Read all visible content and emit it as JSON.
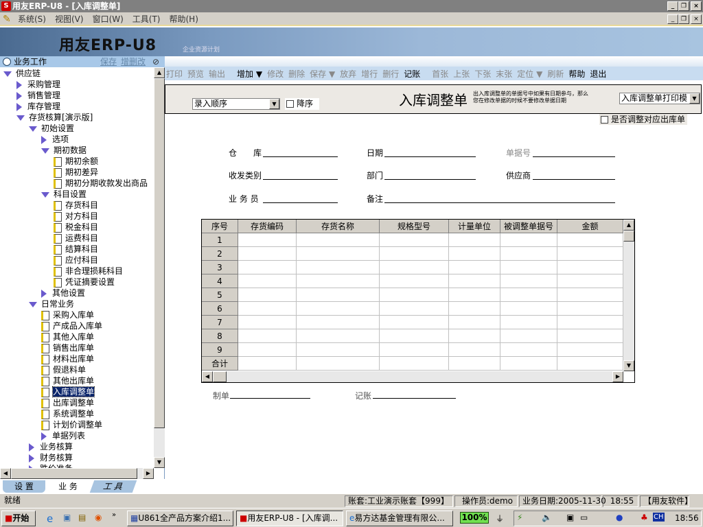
{
  "window": {
    "title": "用友ERP-U8 - [入库调整单]",
    "controls": [
      "_",
      "❐",
      "×"
    ]
  },
  "menu": [
    "系统(S)",
    "视图(V)",
    "窗口(W)",
    "工具(T)",
    "帮助(H)"
  ],
  "banner": {
    "brand": "用友ERP-U8",
    "tagline": "企业资源计划"
  },
  "left": {
    "title": "业务工作",
    "save": "保存",
    "edit": "增删改",
    "tree": [
      {
        "label": "供应链",
        "lvl": 0,
        "type": "open"
      },
      {
        "label": "采购管理",
        "lvl": 1,
        "type": "closed"
      },
      {
        "label": "销售管理",
        "lvl": 1,
        "type": "closed"
      },
      {
        "label": "库存管理",
        "lvl": 1,
        "type": "closed"
      },
      {
        "label": "存货核算[演示版]",
        "lvl": 1,
        "type": "open"
      },
      {
        "label": "初始设置",
        "lvl": 2,
        "type": "open"
      },
      {
        "label": "选项",
        "lvl": 3,
        "type": "closed"
      },
      {
        "label": "期初数据",
        "lvl": 3,
        "type": "open"
      },
      {
        "label": "期初余额",
        "lvl": 4,
        "type": "doc"
      },
      {
        "label": "期初差异",
        "lvl": 4,
        "type": "doc"
      },
      {
        "label": "期初分期收款发出商品",
        "lvl": 4,
        "type": "doc"
      },
      {
        "label": "科目设置",
        "lvl": 3,
        "type": "open"
      },
      {
        "label": "存货科目",
        "lvl": 4,
        "type": "doc"
      },
      {
        "label": "对方科目",
        "lvl": 4,
        "type": "doc"
      },
      {
        "label": "税金科目",
        "lvl": 4,
        "type": "doc"
      },
      {
        "label": "运费科目",
        "lvl": 4,
        "type": "doc"
      },
      {
        "label": "结算科目",
        "lvl": 4,
        "type": "doc"
      },
      {
        "label": "应付科目",
        "lvl": 4,
        "type": "doc"
      },
      {
        "label": "非合理损耗科目",
        "lvl": 4,
        "type": "doc"
      },
      {
        "label": "凭证摘要设置",
        "lvl": 4,
        "type": "doc"
      },
      {
        "label": "其他设置",
        "lvl": 3,
        "type": "closed"
      },
      {
        "label": "日常业务",
        "lvl": 2,
        "type": "open"
      },
      {
        "label": "采购入库单",
        "lvl": 3,
        "type": "doc"
      },
      {
        "label": "产成品入库单",
        "lvl": 3,
        "type": "doc"
      },
      {
        "label": "其他入库单",
        "lvl": 3,
        "type": "doc"
      },
      {
        "label": "销售出库单",
        "lvl": 3,
        "type": "doc"
      },
      {
        "label": "材料出库单",
        "lvl": 3,
        "type": "doc"
      },
      {
        "label": "假退料单",
        "lvl": 3,
        "type": "doc"
      },
      {
        "label": "其他出库单",
        "lvl": 3,
        "type": "doc"
      },
      {
        "label": "入库调整单",
        "lvl": 3,
        "type": "doc",
        "selected": true
      },
      {
        "label": "出库调整单",
        "lvl": 3,
        "type": "doc"
      },
      {
        "label": "系统调整单",
        "lvl": 3,
        "type": "doc"
      },
      {
        "label": "计划价调整单",
        "lvl": 3,
        "type": "doc"
      },
      {
        "label": "单据列表",
        "lvl": 3,
        "type": "closed"
      },
      {
        "label": "业务核算",
        "lvl": 2,
        "type": "closed"
      },
      {
        "label": "财务核算",
        "lvl": 2,
        "type": "closed"
      },
      {
        "label": "跌价准备",
        "lvl": 2,
        "type": "closed"
      }
    ],
    "tabs": [
      "设 置",
      "业 务",
      "工 具"
    ],
    "active_tab": 1
  },
  "toolbar": [
    {
      "label": "打印",
      "enabled": false
    },
    {
      "label": "预览",
      "enabled": false
    },
    {
      "label": "输出",
      "enabled": false
    },
    {
      "label": "增加 ▼",
      "enabled": true
    },
    {
      "label": "修改",
      "enabled": false
    },
    {
      "label": "删除",
      "enabled": false
    },
    {
      "label": "保存 ▼",
      "enabled": false
    },
    {
      "label": "放弃",
      "enabled": false
    },
    {
      "label": "增行",
      "enabled": false
    },
    {
      "label": "删行",
      "enabled": false
    },
    {
      "label": "记账",
      "enabled": true
    },
    {
      "label": "首张",
      "enabled": false
    },
    {
      "label": "上张",
      "enabled": false
    },
    {
      "label": "下张",
      "enabled": false
    },
    {
      "label": "末张",
      "enabled": false
    },
    {
      "label": "定位 ▼",
      "enabled": false
    },
    {
      "label": "刷新",
      "enabled": false
    },
    {
      "label": "帮助",
      "enabled": true
    },
    {
      "label": "退出",
      "enabled": true
    }
  ],
  "form": {
    "sort": "录入顺序",
    "desc": "降序",
    "title": "入库调整单",
    "note1": "出入库调整单的单据号中如果有日期参与，那么",
    "note2": "您在修改单据的时候不要修改单据日期",
    "template": "入库调整单打印模",
    "adjust_out": "是否调整对应出库单",
    "fields": {
      "warehouse": "仓　　库",
      "date": "日期",
      "voucher_no": "单据号",
      "category": "收发类别",
      "dept": "部门",
      "supplier": "供应商",
      "clerk": "业 务 员",
      "remark": "备注"
    },
    "maker": "制单",
    "poster": "记账"
  },
  "grid": {
    "columns": [
      "序号",
      "存货编码",
      "存货名称",
      "规格型号",
      "计量单位",
      "被调整单据号",
      "金额"
    ],
    "rows": [
      "1",
      "2",
      "3",
      "4",
      "5",
      "6",
      "7",
      "8",
      "9"
    ],
    "total": "合计"
  },
  "status": {
    "ready": "就绪",
    "account": "账套:工业演示账套【999】",
    "operator": "操作员:demo",
    "bizdate": "业务日期:2005-11-30",
    "time": "18:55",
    "company": "【用友软件】"
  },
  "taskbar": {
    "start": "开始",
    "tasks": [
      "U861全产品方案介绍1...",
      "用友ERP-U8 - [入库调...",
      "易方达基金管理有限公..."
    ],
    "battery": "100%",
    "lang": "CH",
    "clock": "18:56"
  }
}
